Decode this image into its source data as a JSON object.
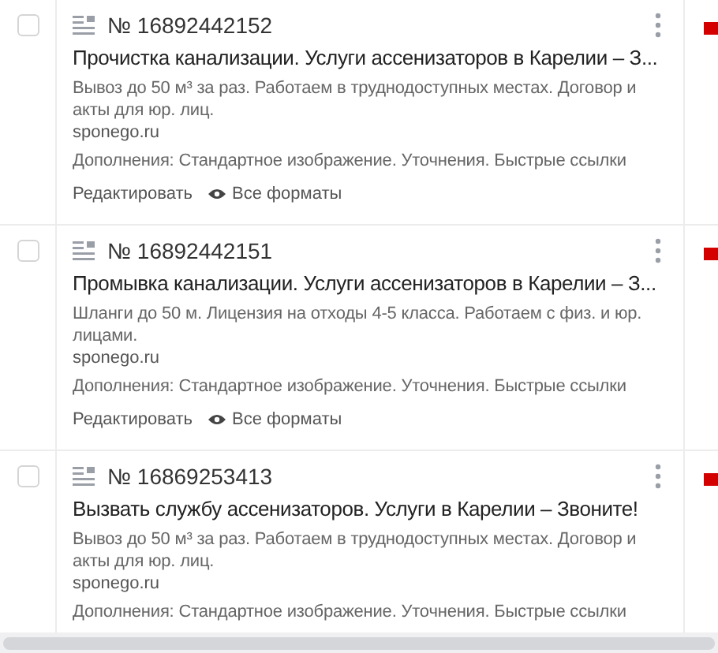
{
  "ads": [
    {
      "number": "№ 16892442152",
      "checked": false,
      "title": "Прочистка канализации. Услуги ассенизаторов в Карелии – З...",
      "text": "Вывоз до 50 м³ за раз. Работаем в труднодоступных местах. Договор и акты для юр. лиц.",
      "domain": "sponego.ru",
      "additions": "Дополнения: Стандартное изображение. Уточнения. Быстрые ссылки",
      "edit": "Редактировать",
      "formats": "Все форматы"
    },
    {
      "number": "№ 16892442151",
      "checked": false,
      "title": "Промывка канализации. Услуги ассенизаторов в Карелии – З...",
      "text": "Шланги до 50 м. Лицензия на отходы 4-5 класса. Работаем с физ. и юр. лицами.",
      "domain": "sponego.ru",
      "additions": "Дополнения: Стандартное изображение. Уточнения. Быстрые ссылки",
      "edit": "Редактировать",
      "formats": "Все форматы"
    },
    {
      "number": "№ 16869253413",
      "checked": false,
      "title": "Вызвать службу ассенизаторов. Услуги в Карелии – Звоните!",
      "text": "Вывоз до 50 м³ за раз. Работаем в труднодоступных местах. Договор и акты для юр. лиц.",
      "domain": "sponego.ru",
      "additions": "Дополнения: Стандартное изображение. Уточнения. Быстрые ссылки"
    }
  ]
}
